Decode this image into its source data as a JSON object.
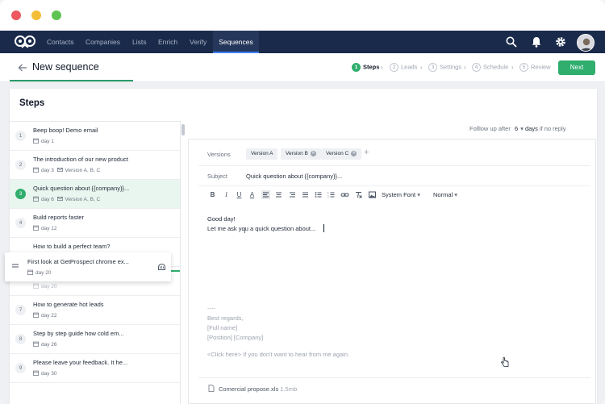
{
  "window_controls": {
    "close_color": "#ec5a5f",
    "minimize_color": "#f4bd38",
    "maximize_color": "#5fc451"
  },
  "nav": {
    "items": [
      {
        "label": "Contacts"
      },
      {
        "label": "Companies"
      },
      {
        "label": "Lists"
      },
      {
        "label": "Enrich"
      },
      {
        "label": "Verify"
      },
      {
        "label": "Sequences",
        "active": true
      }
    ],
    "icons": [
      "search-icon",
      "bell-icon",
      "gear-icon"
    ]
  },
  "header": {
    "title": "New sequence",
    "next_label": "Next",
    "stepper": [
      {
        "num": "1",
        "label": "Steps",
        "active": true
      },
      {
        "num": "2",
        "label": "Leads"
      },
      {
        "num": "3",
        "label": "Settings"
      },
      {
        "num": "4",
        "label": "Schedule"
      },
      {
        "num": "5",
        "label": "Review"
      }
    ]
  },
  "steps": {
    "title": "Steps",
    "items": [
      {
        "num": "1",
        "title": "Beep boop! Demo email",
        "day": "day 1",
        "versions": ""
      },
      {
        "num": "2",
        "title": "The introduction of our new product",
        "day": "day 3",
        "versions": "Version A, B, C"
      },
      {
        "num": "3",
        "title": "Quick question about {{company}}...",
        "day": "day 6",
        "versions": "Version A, B, C",
        "active": true
      },
      {
        "num": "4",
        "title": "Build reports faster",
        "day": "day 12",
        "versions": ""
      },
      {
        "num": "",
        "title": "How to build a perfect team?",
        "day": "",
        "versions": ""
      },
      {
        "num": "",
        "title": "",
        "day": "day 20",
        "versions": ""
      },
      {
        "num": "7",
        "title": "How to generate hot leads",
        "day": "day 22",
        "versions": ""
      },
      {
        "num": "8",
        "title": "Step by step guide how cold em...",
        "day": "day 26",
        "versions": ""
      },
      {
        "num": "9",
        "title": "Please leave your feedback. It he...",
        "day": "day 30",
        "versions": ""
      }
    ],
    "dragging": {
      "title": "First look at GetProspect chrome ex...",
      "day": "day 20"
    }
  },
  "editor": {
    "followup_prefix": "Folllow up after",
    "followup_days": "6",
    "followup_suffix_bold": "days",
    "followup_suffix": "if no reply",
    "versions_label": "Versions",
    "versions": [
      "Version A",
      "Version B",
      "Version C"
    ],
    "add_version": "+",
    "subject_label": "Subject",
    "subject_value": "Quick question about {{company}}...",
    "font_select": "System Font",
    "size_select": "Normal",
    "body": [
      "Good day!",
      "Let me ask you a quick question about..."
    ],
    "signature": [
      "----",
      "Best regards,",
      "[Full name]",
      "[Position] [Company]"
    ],
    "unsubscribe": "<Click here> If you don't want to hear from me again.",
    "attachment_name": "Comercial propose.xls",
    "attachment_size": "1.5mb"
  },
  "colors": {
    "navbar": "#1a2a4a",
    "accent": "#2fae6e"
  }
}
